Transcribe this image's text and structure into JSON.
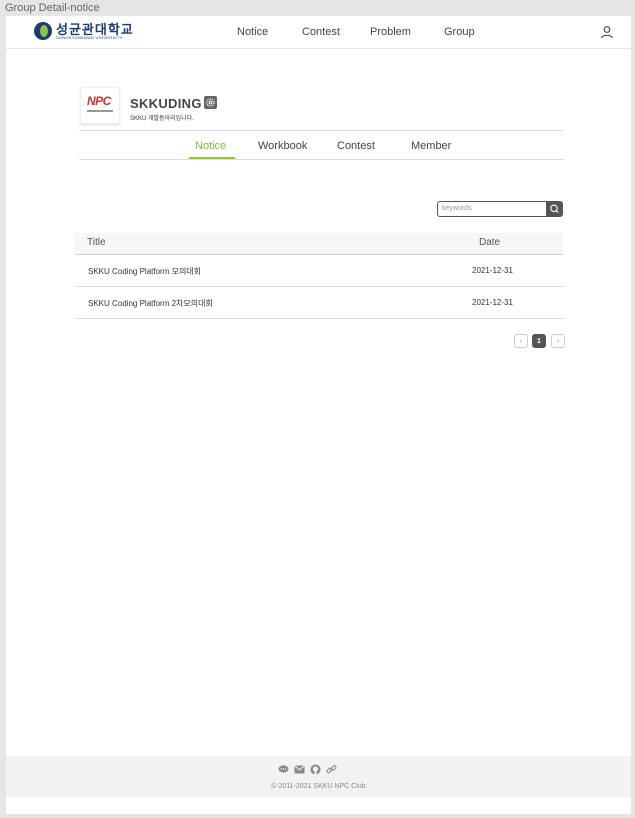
{
  "frame_label": "Group Detail-notice",
  "header": {
    "logo_title": "성균관대학교",
    "logo_subtitle": "SUNGKYUNKWAN UNIVERSITY",
    "nav": [
      "Notice",
      "Contest",
      "Problem",
      "Group"
    ],
    "user_icon": "user-icon"
  },
  "group": {
    "logo_text": "NPC",
    "name": "SKKUDING",
    "description": "SKKU 개발동아리입니다.",
    "settings_icon": "gear-icon"
  },
  "tabs": [
    {
      "label": "Notice",
      "active": true
    },
    {
      "label": "Workbook",
      "active": false
    },
    {
      "label": "Contest",
      "active": false
    },
    {
      "label": "Member",
      "active": false
    }
  ],
  "search": {
    "placeholder": "keywords",
    "icon": "search-icon"
  },
  "table": {
    "columns": [
      "Title",
      "Date"
    ],
    "rows": [
      {
        "title": "SKKU Coding Platform 모의대회",
        "date": "2021-12-31"
      },
      {
        "title": "SKKU Coding Platform 2차모의대회",
        "date": "2021-12-31"
      }
    ]
  },
  "pagination": {
    "prev": "‹",
    "current": "1",
    "next": "›"
  },
  "footer": {
    "icons": [
      "chat-icon",
      "mail-icon",
      "github-icon",
      "link-icon"
    ],
    "copyright": "© 2011-2021 SKKU NPC Club"
  },
  "colors": {
    "accent": "#8fc43f",
    "brand": "#1c3d73",
    "button": "#555555"
  }
}
